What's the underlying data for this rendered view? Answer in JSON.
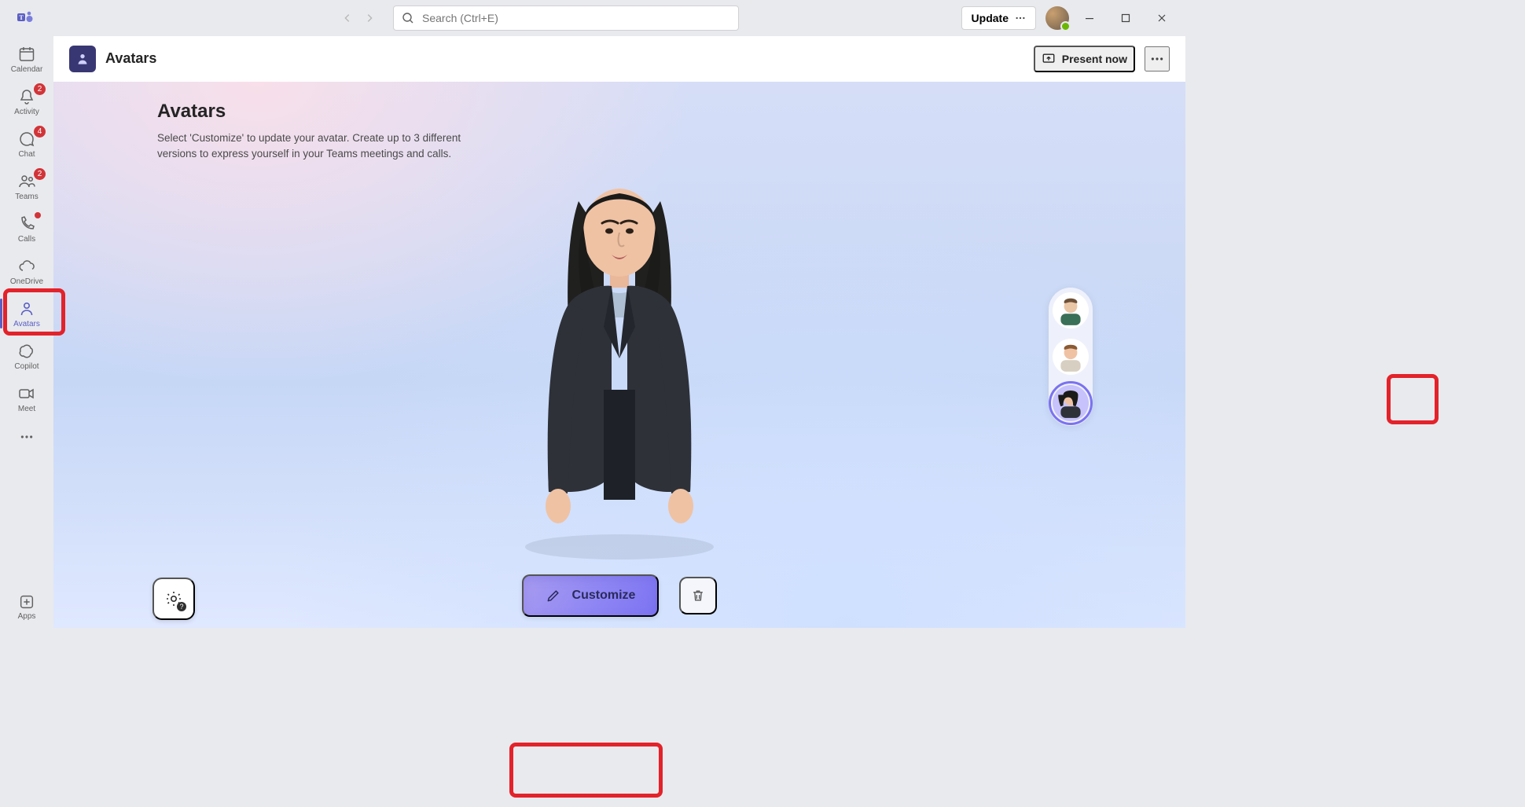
{
  "title_bar": {
    "search_placeholder": "Search (Ctrl+E)",
    "update_label": "Update"
  },
  "rail": {
    "items": [
      {
        "id": "calendar",
        "label": "Calendar",
        "badge": null
      },
      {
        "id": "activity",
        "label": "Activity",
        "badge": "2"
      },
      {
        "id": "chat",
        "label": "Chat",
        "badge": "4"
      },
      {
        "id": "teams",
        "label": "Teams",
        "badge": "2"
      },
      {
        "id": "calls",
        "label": "Calls",
        "badge": "dot"
      },
      {
        "id": "onedrive",
        "label": "OneDrive",
        "badge": null
      },
      {
        "id": "avatars",
        "label": "Avatars",
        "badge": null,
        "selected": true
      },
      {
        "id": "copilot",
        "label": "Copilot",
        "badge": null
      },
      {
        "id": "meet",
        "label": "Meet",
        "badge": null
      }
    ],
    "apps_label": "Apps"
  },
  "page": {
    "title": "Avatars",
    "present_label": "Present now",
    "heading": "Avatars",
    "description": "Select 'Customize' to update your avatar. Create up to 3 different versions to express yourself in your Teams meetings and calls."
  },
  "actions": {
    "customize_label": "Customize"
  },
  "thumbs": {
    "count": 3,
    "selected_index": 2
  }
}
